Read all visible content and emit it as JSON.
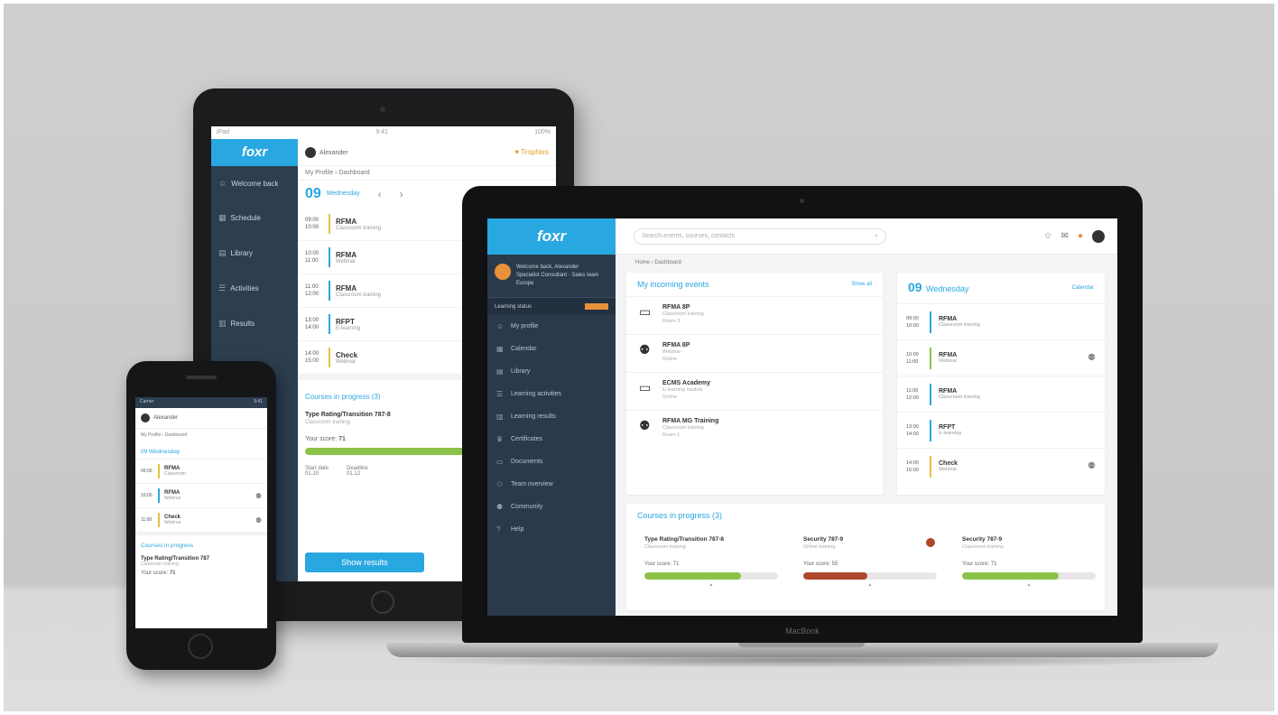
{
  "brand": {
    "logo": "foxr",
    "accent": "#29a7e1",
    "sidebar_color": "#2b3a4a",
    "laptop_label": "MacBook"
  },
  "laptop": {
    "search": {
      "placeholder": "Search events, courses, contacts"
    },
    "breadcrumb": "Home › Dashboard",
    "user": {
      "name": "Welcome back, Alexander",
      "details": "Specialist Consultant · Sales team Europe"
    },
    "user_bar": {
      "label": "Learning status"
    },
    "nav": [
      {
        "icon": "user-icon",
        "label": "My profile"
      },
      {
        "icon": "calendar-icon",
        "label": "Calendar"
      },
      {
        "icon": "book-icon",
        "label": "Library"
      },
      {
        "icon": "list-icon",
        "label": "Learning activities"
      },
      {
        "icon": "chart-icon",
        "label": "Learning results"
      },
      {
        "icon": "trophy-icon",
        "label": "Certificates"
      },
      {
        "icon": "doc-icon",
        "label": "Documents"
      },
      {
        "icon": "team-icon",
        "label": "Team overview"
      },
      {
        "icon": "people-icon",
        "label": "Community"
      },
      {
        "icon": "help-icon",
        "label": "Help"
      }
    ],
    "upcoming": {
      "title": "My incoming events",
      "link": "Show all",
      "events": [
        {
          "icon": "doc-icon",
          "name": "RFMA 8P",
          "sub": "Classroom training",
          "meta": "Room 3"
        },
        {
          "icon": "people-icon",
          "name": "RFMA 8P",
          "sub": "Webinar",
          "meta": "Online"
        },
        {
          "icon": "doc-icon",
          "name": "ECMS Academy",
          "sub": "E-learning module",
          "meta": "Online"
        },
        {
          "icon": "people-icon",
          "name": "RFMA MG Training",
          "sub": "Classroom training",
          "meta": "Room 1"
        }
      ]
    },
    "calendar": {
      "day": "09",
      "weekday": "Wednesday",
      "link": "Calendar",
      "rows": [
        {
          "time": "09:00",
          "end": "10:00",
          "name": "RFMA",
          "sub": "Classroom training",
          "color": "#29a7e1",
          "action": ""
        },
        {
          "time": "10:00",
          "end": "11:00",
          "name": "RFMA",
          "sub": "Webinar",
          "color": "#8bc34a",
          "action": "people-icon"
        },
        {
          "time": "11:00",
          "end": "12:00",
          "name": "RFMA",
          "sub": "Classroom training",
          "color": "#29a7e1",
          "action": ""
        },
        {
          "time": "13:00",
          "end": "14:00",
          "name": "RFPT",
          "sub": "E-learning",
          "color": "#29a7e1",
          "action": ""
        },
        {
          "time": "14:00",
          "end": "15:00",
          "name": "Check",
          "sub": "Webinar",
          "color": "#e5c23d",
          "action": "people-icon"
        }
      ]
    },
    "courses": {
      "title": "Courses in progress (3)",
      "items": [
        {
          "name": "Type Rating/Transition 787-8",
          "sub": "Classroom training",
          "score_label": "Your score:",
          "score": "71",
          "progress": 0.72,
          "color": "#8bc34a",
          "flag": false
        },
        {
          "name": "Security 787-9",
          "sub": "Online training",
          "score_label": "Your score:",
          "score": "55",
          "progress": 0.48,
          "color": "#b0462b",
          "flag": true
        },
        {
          "name": "Security 787-9",
          "sub": "Classroom training",
          "score_label": "Your score:",
          "score": "71",
          "progress": 0.72,
          "color": "#8bc34a",
          "flag": false
        }
      ]
    }
  },
  "tablet": {
    "status": {
      "carrier": "iPad",
      "time": "9:41",
      "battery": "100%"
    },
    "user": "Alexander",
    "badge": "Trophies",
    "breadcrumb": "My Profile › Dashboard",
    "nav": [
      {
        "icon": "user-icon",
        "label": "Welcome back"
      },
      {
        "icon": "calendar-icon",
        "label": "Schedule"
      },
      {
        "icon": "book-icon",
        "label": "Library"
      },
      {
        "icon": "list-icon",
        "label": "Activities"
      },
      {
        "icon": "chart-icon",
        "label": "Results"
      }
    ],
    "day": "09",
    "weekday": "Wednesday",
    "schedule": [
      {
        "time": "09:00",
        "end": "10:00",
        "name": "RFMA",
        "sub": "Classroom training",
        "color": "#e5c23d"
      },
      {
        "time": "10:00",
        "end": "11:00",
        "name": "RFMA",
        "sub": "Webinar",
        "color": "#29a7e1"
      },
      {
        "time": "11:00",
        "end": "12:00",
        "name": "RFMA",
        "sub": "Classroom training",
        "color": "#29a7e1"
      },
      {
        "time": "13:00",
        "end": "14:00",
        "name": "RFPT",
        "sub": "E-learning",
        "color": "#29a7e1"
      },
      {
        "time": "14:00",
        "end": "15:00",
        "name": "Check",
        "sub": "Webinar",
        "color": "#e5c23d"
      }
    ],
    "courses_title": "Courses in progress (3)",
    "course": {
      "name": "Type Rating/Transition 787-8",
      "sub": "Classroom training",
      "score_label": "Your score:",
      "score": "71",
      "progress": 0.9,
      "color": "#8bc34a"
    },
    "stats": [
      {
        "label": "Start date",
        "value": "01.10"
      },
      {
        "label": "Deadline",
        "value": "01.12"
      }
    ],
    "button": "Show results"
  },
  "phone": {
    "status": {
      "carrier": "Carrier",
      "time": "9:41"
    },
    "user": "Alexander",
    "breadcrumb": "My Profile › Dashboard",
    "section": "09 Wednesday",
    "rows": [
      {
        "time": "09:00",
        "name": "RFMA",
        "sub": "Classroom",
        "color": "#e5c23d",
        "action": ""
      },
      {
        "time": "10:00",
        "name": "RFMA",
        "sub": "Webinar",
        "color": "#29a7e1",
        "action": "people-icon"
      },
      {
        "time": "11:00",
        "name": "Check",
        "sub": "Webinar",
        "color": "#e5c23d",
        "action": "people-icon"
      }
    ],
    "courses_title": "Courses in progress",
    "course": {
      "name": "Type Rating/Transition 787",
      "sub": "Classroom training",
      "score_label": "Your score:",
      "score": "71"
    }
  }
}
